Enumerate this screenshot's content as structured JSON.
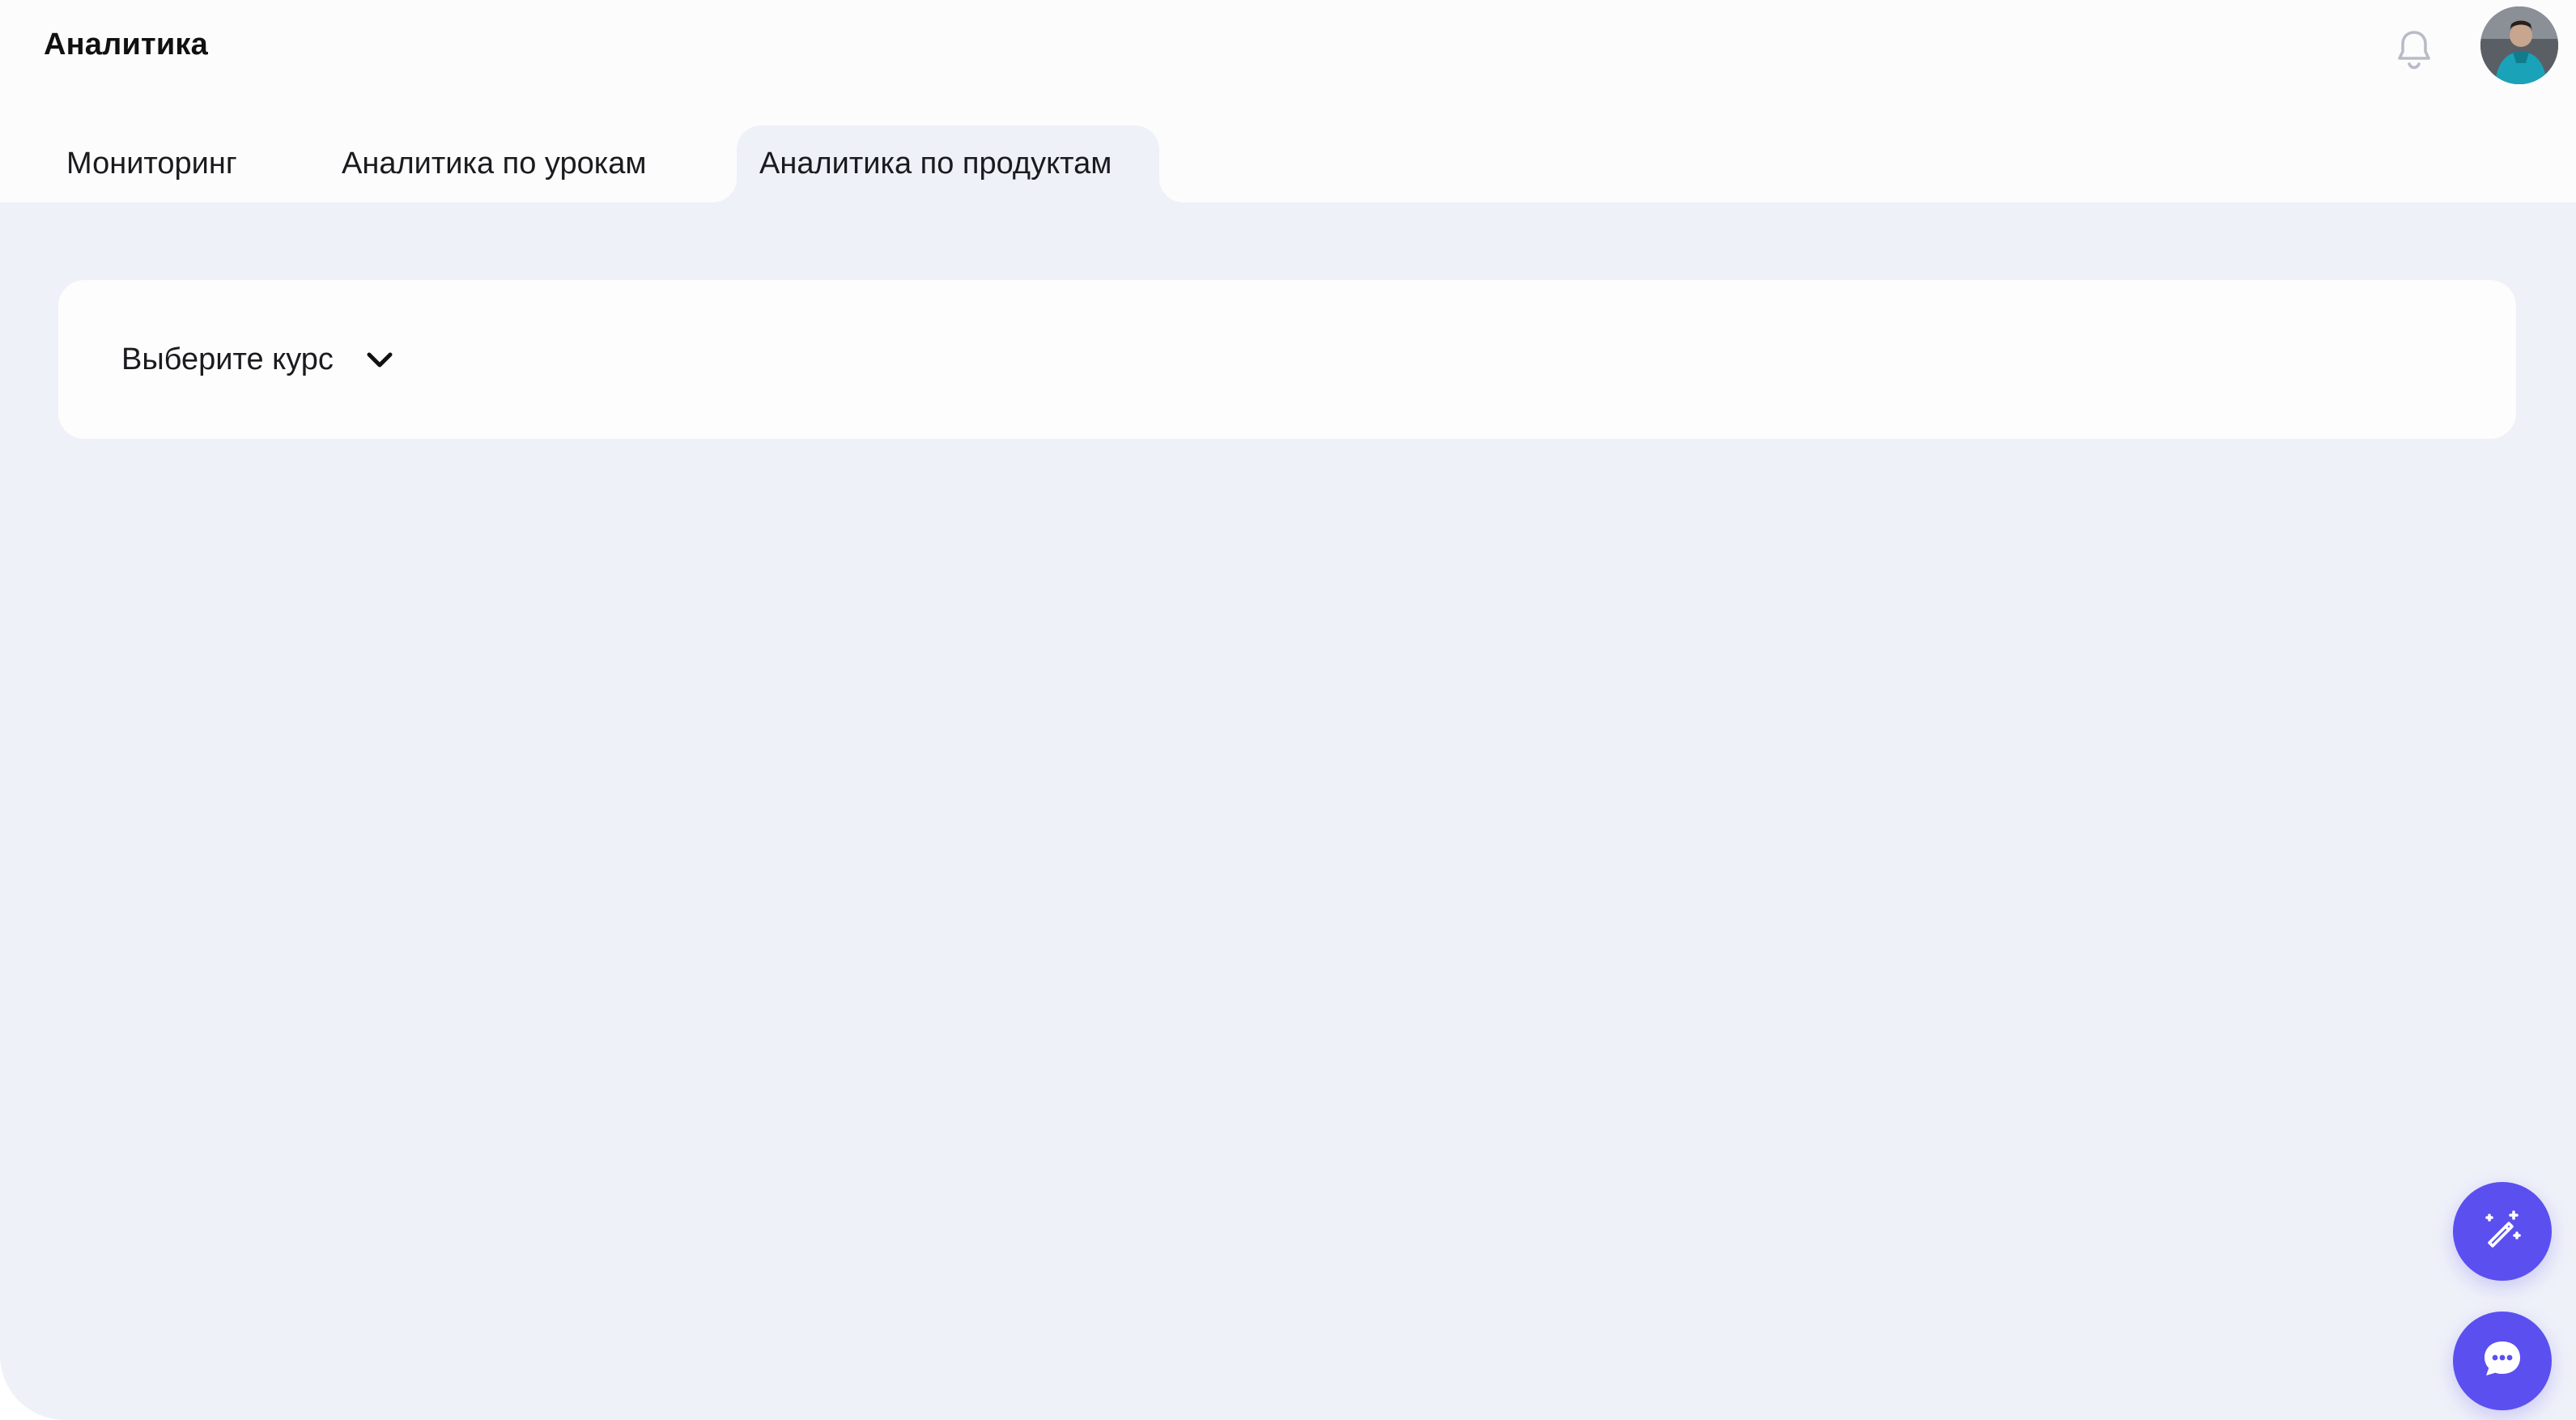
{
  "header": {
    "title": "Аналитика",
    "bell_icon": "bell-icon",
    "avatar_icon": "user-avatar"
  },
  "tabs": [
    {
      "label": "Мониторинг",
      "active": false
    },
    {
      "label": "Аналитика по урокам",
      "active": false
    },
    {
      "label": "Аналитика по продуктам",
      "active": true
    }
  ],
  "course_filter": {
    "label": "Выберите курс",
    "icon": "chevron-down-icon"
  },
  "fabs": {
    "magic": {
      "icon": "magic-wand-icon"
    },
    "chat": {
      "icon": "chat-bubble-icon"
    }
  },
  "colors": {
    "accent": "#5b4ff0",
    "background": "#eff1f9",
    "surface": "#fdfdfe"
  }
}
